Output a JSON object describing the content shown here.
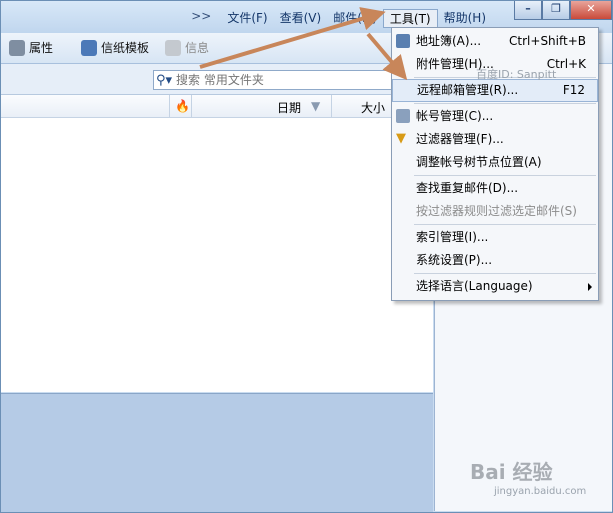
{
  "menubar": {
    "more": ">>",
    "items": [
      "文件(F)",
      "查看(V)",
      "邮件(M)",
      "工具(T)",
      "帮助(H)"
    ]
  },
  "window_controls": {
    "minimize": "–",
    "restore": "❐",
    "close": "✕"
  },
  "toolbar": {
    "properties": "属性",
    "stationery": "信纸模板",
    "info": "信息"
  },
  "search": {
    "placeholder": "搜索 常用文件夹"
  },
  "list_header": {
    "date": "日期",
    "size": "大小"
  },
  "tools_menu": {
    "items": [
      {
        "label": "地址簿(A)...",
        "shortcut": "Ctrl+Shift+B"
      },
      {
        "label": "附件管理(H)...",
        "shortcut": "Ctrl+K"
      },
      {
        "label": "远程邮箱管理(R)...",
        "shortcut": "F12"
      },
      {
        "label": "帐号管理(C)..."
      },
      {
        "label": "过滤器管理(F)..."
      },
      {
        "label": "调整帐号树节点位置(A)"
      },
      {
        "label": "查找重复邮件(D)..."
      },
      {
        "label": "按过滤器规则过滤选定邮件(S)"
      },
      {
        "label": "索引管理(I)..."
      },
      {
        "label": "系统设置(P)..."
      },
      {
        "label": "选择语言(Language)"
      }
    ]
  },
  "watermark": {
    "top": "百度ID: Sanpitt",
    "bottom_logo": "Bai 经验",
    "bottom_url": "jingyan.baidu.com"
  },
  "colors": {
    "annotation_arrow": "#c8865a",
    "menu_highlight": "#e3ecf8"
  }
}
